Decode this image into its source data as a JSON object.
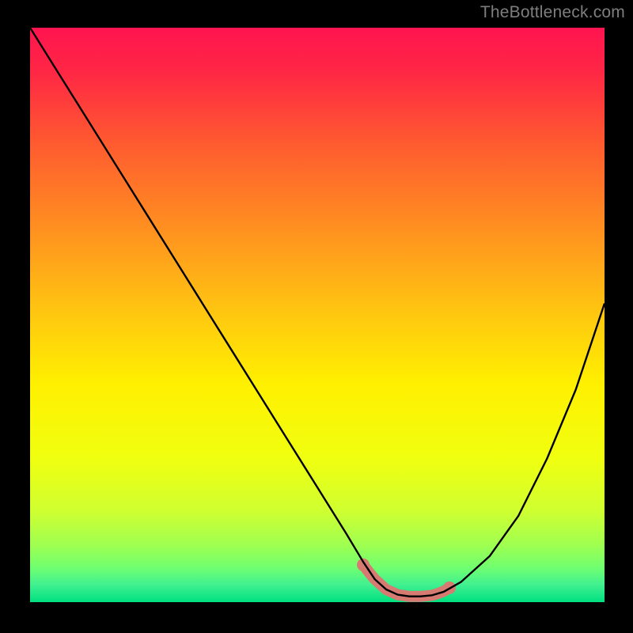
{
  "attribution": "TheBottleneck.com",
  "colors": {
    "background": "#000000",
    "gradient_stops": [
      {
        "offset": 0.0,
        "color": "#ff1450"
      },
      {
        "offset": 0.08,
        "color": "#ff2844"
      },
      {
        "offset": 0.2,
        "color": "#ff5a30"
      },
      {
        "offset": 0.35,
        "color": "#ff9020"
      },
      {
        "offset": 0.5,
        "color": "#ffc810"
      },
      {
        "offset": 0.62,
        "color": "#fff000"
      },
      {
        "offset": 0.75,
        "color": "#f0ff10"
      },
      {
        "offset": 0.84,
        "color": "#d0ff30"
      },
      {
        "offset": 0.9,
        "color": "#a0ff50"
      },
      {
        "offset": 0.94,
        "color": "#70ff70"
      },
      {
        "offset": 0.97,
        "color": "#40f090"
      },
      {
        "offset": 1.0,
        "color": "#00e080"
      }
    ],
    "curve": "#000000",
    "marker_fill": "#d67a72",
    "marker_stroke": "#c76a62"
  },
  "chart_data": {
    "type": "line",
    "title": "",
    "xlabel": "",
    "ylabel": "",
    "xlim": [
      0,
      100
    ],
    "ylim": [
      0,
      100
    ],
    "series": [
      {
        "name": "bottleneck-curve",
        "x": [
          0,
          5,
          10,
          15,
          20,
          25,
          30,
          35,
          40,
          45,
          50,
          55,
          58,
          60,
          62,
          64,
          66,
          68,
          70,
          72,
          75,
          80,
          85,
          90,
          95,
          100
        ],
        "y": [
          100,
          92,
          84,
          76,
          68,
          60,
          52,
          44,
          36,
          28,
          20,
          12,
          7,
          4,
          2.2,
          1.3,
          1.0,
          1.0,
          1.2,
          1.8,
          3.5,
          8,
          15,
          25,
          37,
          52
        ]
      }
    ],
    "markers": {
      "name": "highlighted-range",
      "x": [
        58,
        59,
        60,
        62,
        64,
        66,
        68,
        70,
        71,
        72,
        73
      ],
      "y": [
        6.5,
        5.2,
        4.0,
        2.2,
        1.3,
        1.0,
        1.0,
        1.2,
        1.5,
        1.9,
        2.5
      ]
    }
  }
}
